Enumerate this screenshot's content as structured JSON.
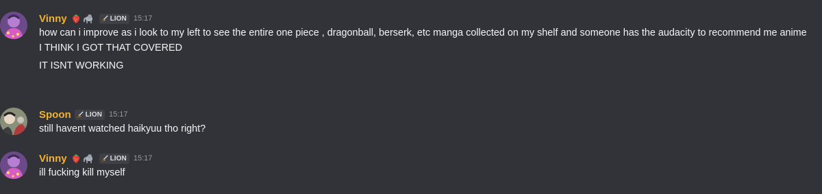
{
  "messages": [
    {
      "username": "Vinny",
      "badges": [
        "strawberry-emoji",
        "elephant-emoji"
      ],
      "role": "LION",
      "time": "15:17",
      "lines": [
        "how can i improve as i look to my left to see the entire one piece , dragonball, berserk, etc manga collected on my shelf and someone has the audacity to recommend me anime",
        "I THINK I GOT THAT COVERED",
        "IT ISNT WORKING"
      ]
    },
    {
      "username": "Spoon",
      "badges": [],
      "role": "LION",
      "time": "15:17",
      "lines": [
        "still havent watched haikyuu tho right?"
      ]
    },
    {
      "username": "Vinny",
      "badges": [
        "strawberry-emoji",
        "elephant-emoji"
      ],
      "role": "LION",
      "time": "15:17",
      "lines": [
        "ill fucking kill myself"
      ]
    }
  ],
  "colors": {
    "background": "#313338",
    "username": "#f0b232",
    "text": "#f2f3f5",
    "timestamp": "#949ba4",
    "role_tag_bg": "#3f4147"
  }
}
